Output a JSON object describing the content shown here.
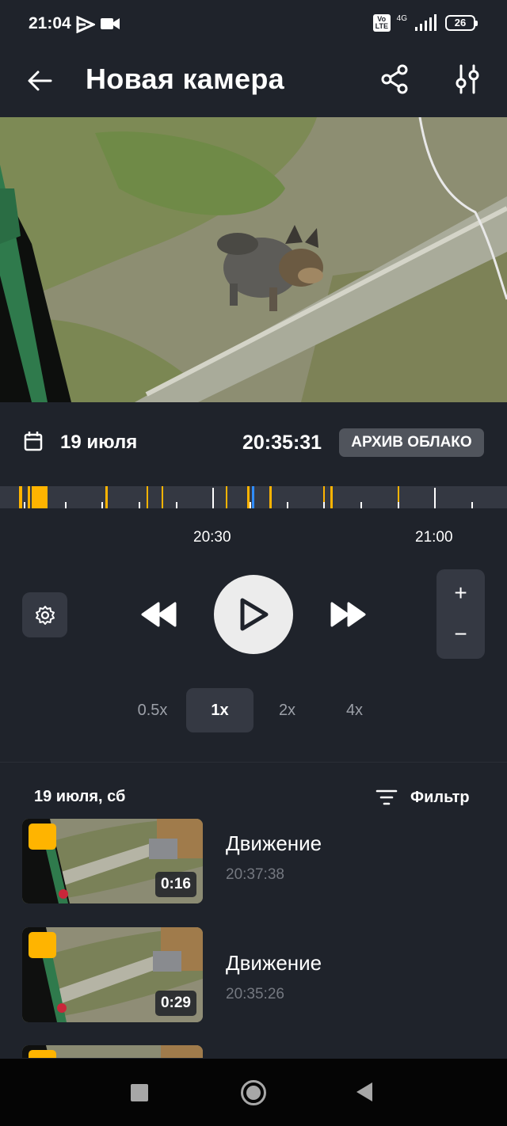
{
  "status_bar": {
    "time": "21:04",
    "icons": [
      "play-logo-icon",
      "video-camera-icon"
    ],
    "volte": "Vo LTE",
    "network": "4G",
    "battery": "26"
  },
  "app_bar": {
    "title": "Новая камера",
    "back_icon": "arrow-back-icon",
    "share_icon": "share-icon",
    "tune_icon": "tune-icon"
  },
  "player": {
    "date": "19 июля",
    "time": "20:35:31",
    "archive_badge": "АРХИВ ОБЛАКО",
    "timeline_labels": [
      "20:30",
      "21:00"
    ],
    "zoom_in": "+",
    "zoom_out": "−"
  },
  "speeds": [
    {
      "label": "0.5x",
      "active": false
    },
    {
      "label": "1x",
      "active": true
    },
    {
      "label": "2x",
      "active": false
    },
    {
      "label": "4x",
      "active": false
    }
  ],
  "list": {
    "date_header": "19 июля, сб",
    "filter_label": "Фильтр",
    "events": [
      {
        "title": "Движение",
        "time": "20:37:38",
        "duration": "0:16"
      },
      {
        "title": "Движение",
        "time": "20:35:26",
        "duration": "0:29"
      },
      {
        "title": "",
        "time": "",
        "duration": ""
      }
    ]
  },
  "colors": {
    "background": "#1f232b",
    "accent_event": "#ffb400",
    "playhead": "#2f8cff",
    "panel": "#353943"
  }
}
